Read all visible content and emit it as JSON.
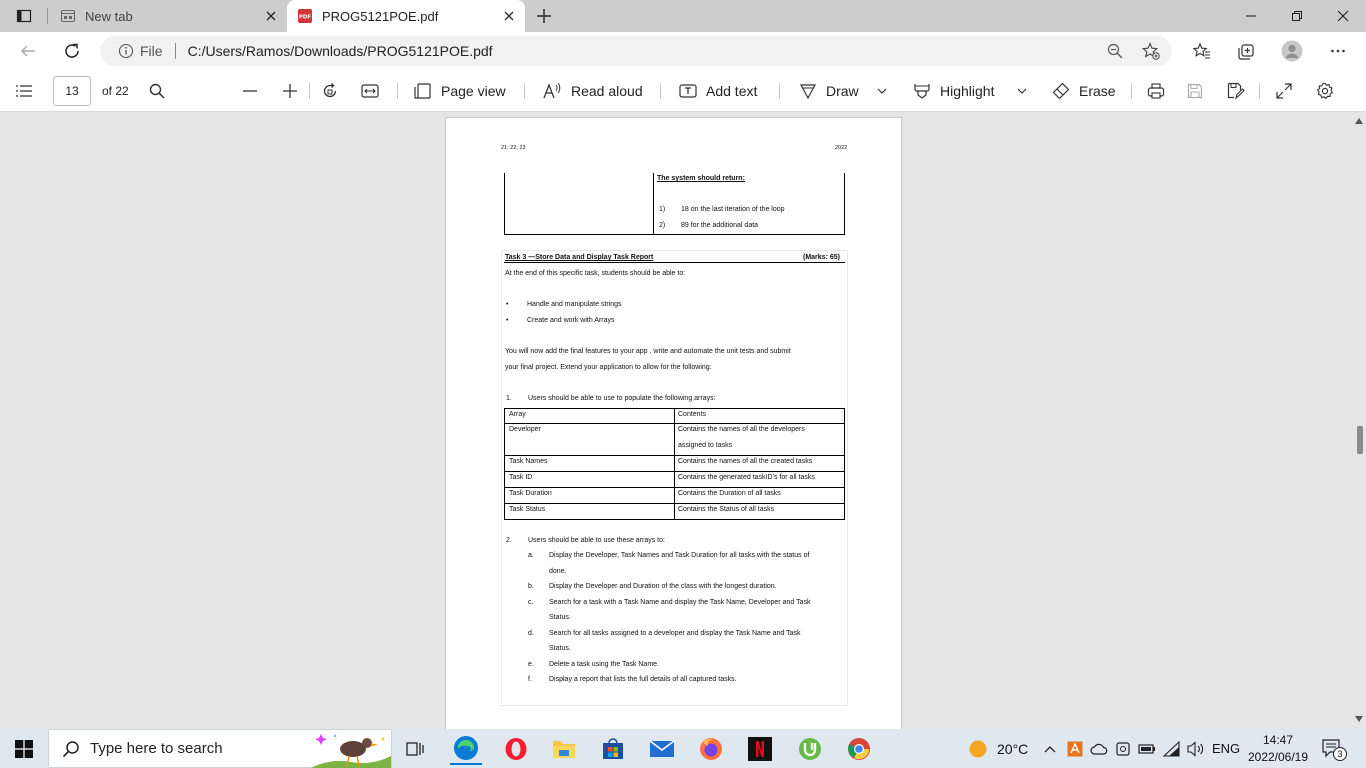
{
  "browser": {
    "tabs": [
      {
        "title": "New tab"
      },
      {
        "title": "PROG5121POE.pdf"
      }
    ],
    "address": {
      "scheme_label": "File",
      "url": "C:/Users/Ramos/Downloads/PROG5121POE.pdf"
    }
  },
  "pdf_toolbar": {
    "page_number": "13",
    "page_total": "of 22",
    "page_view": "Page view",
    "read_aloud": "Read aloud",
    "add_text": "Add text",
    "draw": "Draw",
    "highlight": "Highlight",
    "erase": "Erase"
  },
  "document": {
    "header_left": "21; 22; 23",
    "header_right": "2022",
    "return_heading": "The system should return:",
    "return_items": [
      {
        "num": "1)",
        "text": "18 on the last iteration of the loop"
      },
      {
        "num": "2)",
        "text": "89 for the additional data"
      }
    ],
    "task_title": "Task 3 —Store Data and Display Task Report",
    "task_marks": "(Marks: 65)",
    "intro": "At the end of this specific task, students should be able to:",
    "outcomes": [
      "Handle and manipulate strings",
      "Create and work with Arrays"
    ],
    "para1": "You will now add the final features to your app , write and automate the unit tests and submit",
    "para2": "your final project.  Extend your application to allow for the following:",
    "item1_num": "1.",
    "item1": "Users should be able to use to populate the following arrays:",
    "array_table": {
      "headers": [
        "Array",
        "Contents"
      ],
      "rows": [
        {
          "array": "Developer",
          "contents": "Contains the names of all the developers",
          "contents2": "assigned to tasks"
        },
        {
          "array": "Task Names",
          "contents": "Contains the names of all the created tasks"
        },
        {
          "array": "Task ID",
          "contents": "Contains the generated taskID’s for all tasks"
        },
        {
          "array": "Task Duration",
          "contents": "Contains the Duration of all tasks"
        },
        {
          "array": "Task Status",
          "contents": "Contains the Status of all tasks"
        }
      ]
    },
    "item2_num": "2.",
    "item2": "Users should be able to use these arrays to:",
    "sub_items": [
      {
        "letter": "a.",
        "line1": "Display the Developer, Task Names and Task Duration for all tasks with the status of",
        "line2": "done."
      },
      {
        "letter": "b.",
        "line1": "Display the Developer and Duration of the class with the longest duration."
      },
      {
        "letter": "c.",
        "line1": "Search for a task with a Task Name and display the Task Name, Developer and Task",
        "line2": "Status."
      },
      {
        "letter": "d.",
        "line1": "Search for all tasks assigned to a developer and display the Task Name and Task",
        "line2": "Status."
      },
      {
        "letter": "e.",
        "line1": "Delete a task using the Task Name."
      },
      {
        "letter": "f.",
        "line1": "Display a report that lists the full details of all captured tasks."
      }
    ]
  },
  "taskbar": {
    "search_placeholder": "Type here to search",
    "temperature": "20°C",
    "language": "ENG",
    "time": "14:47",
    "date": "2022/06/19",
    "notification_count": "3"
  },
  "colors": {
    "accent_blue": "#0078d4",
    "pdf_red": "#d13438",
    "page_background": "#e6e6e6",
    "taskbar": "#dfe7ef"
  }
}
